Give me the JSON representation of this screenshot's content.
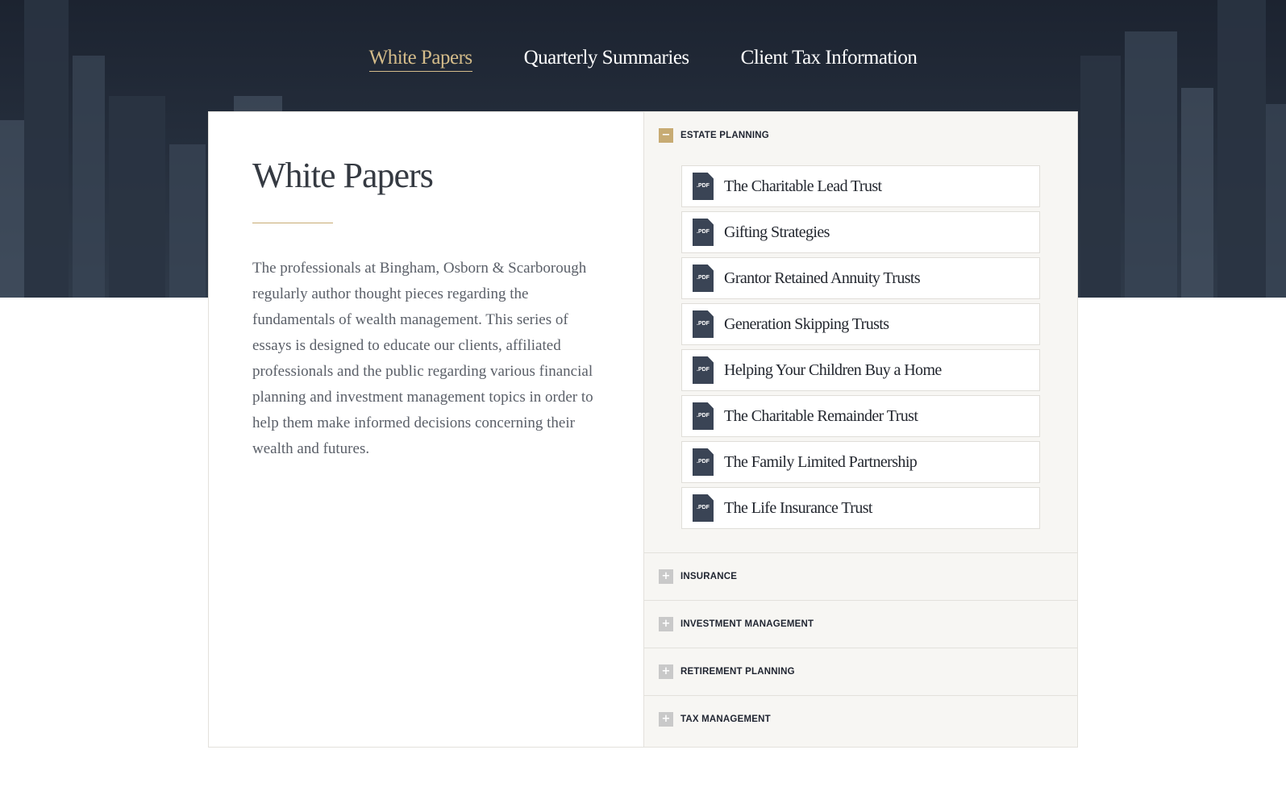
{
  "nav": [
    {
      "label": "White Papers",
      "active": true
    },
    {
      "label": "Quarterly Summaries",
      "active": false
    },
    {
      "label": "Client Tax Information",
      "active": false
    }
  ],
  "page": {
    "title": "White Papers",
    "intro": "The professionals at Bingham, Osborn & Scarborough regularly author thought pieces regarding the fundamentals of wealth management. This series of essays is designed to educate our clients, affiliated professionals and the public regarding various financial planning and investment management topics in order to help them make informed decisions concerning their wealth and futures."
  },
  "accordion": {
    "open_section": {
      "label": "ESTATE PLANNING",
      "toggle": "−",
      "documents": [
        {
          "badge": ".PDF",
          "title": "The Charitable Lead Trust"
        },
        {
          "badge": ".PDF",
          "title": "Gifting Strategies"
        },
        {
          "badge": ".PDF",
          "title": "Grantor Retained Annuity Trusts"
        },
        {
          "badge": ".PDF",
          "title": "Generation Skipping Trusts"
        },
        {
          "badge": ".PDF",
          "title": "Helping Your Children Buy a Home"
        },
        {
          "badge": ".PDF",
          "title": "The Charitable Remainder Trust"
        },
        {
          "badge": ".PDF",
          "title": "The Family Limited Partnership"
        },
        {
          "badge": ".PDF",
          "title": "The Life Insurance Trust"
        }
      ]
    },
    "closed_sections": [
      {
        "label": "INSURANCE",
        "toggle": "+"
      },
      {
        "label": "INVESTMENT MANAGEMENT",
        "toggle": "+"
      },
      {
        "label": "RETIREMENT PLANNING",
        "toggle": "+"
      },
      {
        "label": "TAX MANAGEMENT",
        "toggle": "+"
      }
    ]
  },
  "colors": {
    "accent_gold": "#c7ab73",
    "nav_active": "#d4bc8a",
    "hero_dark": "#1c2330",
    "pdf_icon": "#3a4455"
  }
}
